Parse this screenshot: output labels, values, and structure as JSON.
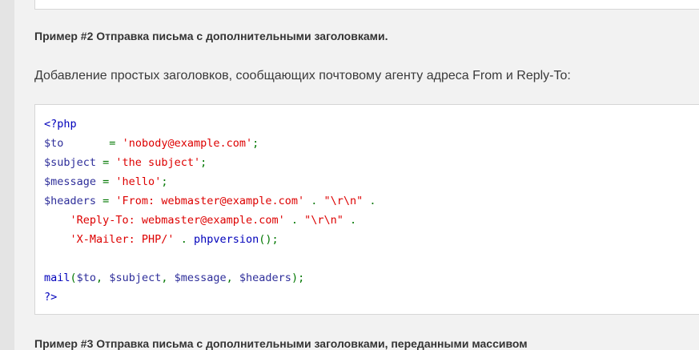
{
  "example2": {
    "title": "Пример #2 Отправка письма с дополнительными заголовками.",
    "description": "Добавление простых заголовков, сообщающих почтовому агенту адреса From и Reply-To:"
  },
  "code": {
    "open_tag": "<?php",
    "l2_var": "$to",
    "l2_pad": "      ",
    "l2_eq": " = ",
    "l2_str": "'nobody@example.com'",
    "l2_end": ";",
    "l3_var": "$subject",
    "l3_eq": " = ",
    "l3_str": "'the subject'",
    "l3_end": ";",
    "l4_var": "$message",
    "l4_eq": " = ",
    "l4_str": "'hello'",
    "l4_end": ";",
    "l5_var": "$headers",
    "l5_eq": " = ",
    "l5_str": "'From: webmaster@example.com'",
    "l5_dot": " . ",
    "l5_str2": "\"\\r\\n\"",
    "l5_end": " .",
    "l6_indent": "    ",
    "l6_str": "'Reply-To: webmaster@example.com'",
    "l6_dot": " . ",
    "l6_str2": "\"\\r\\n\"",
    "l6_end": " .",
    "l7_indent": "    ",
    "l7_str": "'X-Mailer: PHP/'",
    "l7_dot": " . ",
    "l7_fn": "phpversion",
    "l7_end": "();",
    "l9_fn": "mail",
    "l9_open": "(",
    "l9_a1": "$to",
    "l9_c1": ", ",
    "l9_a2": "$subject",
    "l9_c2": ", ",
    "l9_a3": "$message",
    "l9_c3": ", ",
    "l9_a4": "$headers",
    "l9_end": ");",
    "close_tag": "?>"
  },
  "example3": {
    "title": "Пример #3 Отправка письма с дополнительными заголовками, переданными массивом"
  }
}
